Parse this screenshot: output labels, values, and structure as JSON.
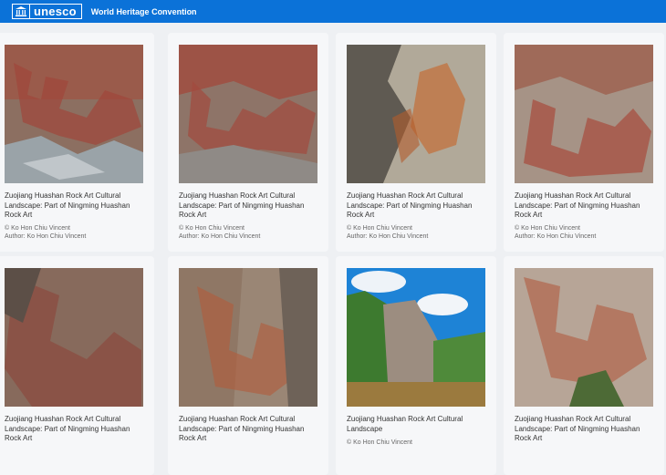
{
  "header": {
    "logo_text": "unesco",
    "convention_link": "World Heritage Convention",
    "brand_color": "#0b72d8"
  },
  "cards": [
    {
      "title": "Zuojiang Huashan Rock Art Cultural Landscape: Part of Ningming Huashan Rock Art",
      "credit": "© Ko Hon Chiu Vincent",
      "author": "Author: Ko Hon Chiu Vincent"
    },
    {
      "title": "Zuojiang Huashan Rock Art Cultural Landscape: Part of Ningming Huashan Rock Art",
      "credit": "© Ko Hon Chiu Vincent",
      "author": "Author: Ko Hon Chiu Vincent"
    },
    {
      "title": "Zuojiang Huashan Rock Art Cultural Landscape: Part of Ningming Huashan Rock Art",
      "credit": "© Ko Hon Chiu Vincent",
      "author": "Author: Ko Hon Chiu Vincent"
    },
    {
      "title": "Zuojiang Huashan Rock Art Cultural Landscape: Part of Ningming Huashan Rock Art",
      "credit": "© Ko Hon Chiu Vincent",
      "author": "Author: Ko Hon Chiu Vincent"
    },
    {
      "title": "Zuojiang Huashan Rock Art Cultural Landscape: Part of Ningming Huashan Rock Art",
      "credit": "",
      "author": ""
    },
    {
      "title": "Zuojiang Huashan Rock Art Cultural Landscape: Part of Ningming Huashan Rock Art",
      "credit": "",
      "author": ""
    },
    {
      "title": "Zuojiang Huashan Rock Art Cultural Landscape",
      "credit": "© Ko Hon Chiu Vincent",
      "author": ""
    },
    {
      "title": "Zuojiang Huashan Rock Art Cultural Landscape: Part of Ningming Huashan Rock Art",
      "credit": "",
      "author": ""
    }
  ]
}
